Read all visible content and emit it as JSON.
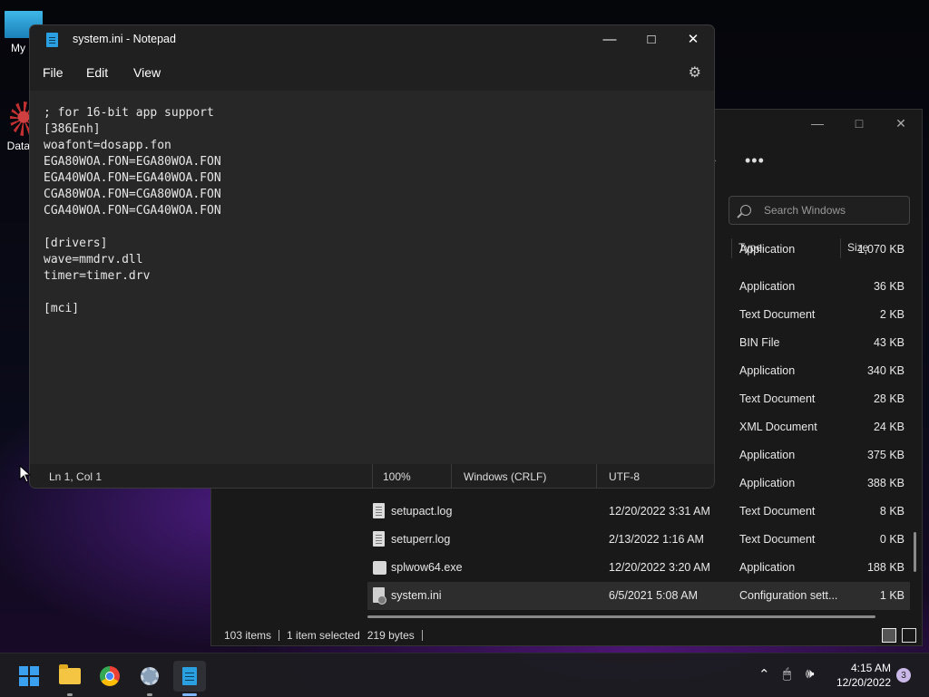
{
  "desktop": {
    "icons": [
      {
        "label": "My C"
      },
      {
        "label": "DataW"
      }
    ]
  },
  "explorer": {
    "search_placeholder": "Search Windows",
    "more_label": "•••",
    "columns": {
      "type": "Type",
      "size": "Size"
    },
    "partial_rows": [
      {
        "type": "Application",
        "size": "1,070 KB"
      },
      {
        "type": "Application",
        "size": "36 KB"
      },
      {
        "type": "Text Document",
        "size": "2 KB"
      },
      {
        "type": "BIN File",
        "size": "43 KB"
      },
      {
        "type": "Application",
        "size": "340 KB"
      },
      {
        "type": "Text Document",
        "size": "28 KB"
      },
      {
        "type": "XML Document",
        "size": "24 KB"
      },
      {
        "type": "Application",
        "size": "375 KB"
      },
      {
        "type": "Application",
        "size": "388 KB"
      }
    ],
    "rows": [
      {
        "name": "setupact.log",
        "date": "12/20/2022 3:31 AM",
        "type": "Text Document",
        "size": "8 KB",
        "icon": "document-icon"
      },
      {
        "name": "setuperr.log",
        "date": "2/13/2022 1:16 AM",
        "type": "Text Document",
        "size": "0 KB",
        "icon": "document-icon"
      },
      {
        "name": "splwow64.exe",
        "date": "12/20/2022 3:20 AM",
        "type": "Application",
        "size": "188 KB",
        "icon": "printer-icon"
      },
      {
        "name": "system.ini",
        "date": "6/5/2021 5:08 AM",
        "type": "Configuration sett...",
        "size": "1 KB",
        "icon": "config-file-icon"
      }
    ],
    "status": {
      "items": "103 items",
      "selected": "1 item selected",
      "bytes": "219 bytes"
    }
  },
  "notepad": {
    "title": "system.ini - Notepad",
    "menu": {
      "file": "File",
      "edit": "Edit",
      "view": "View"
    },
    "content": "; for 16-bit app support\n[386Enh]\nwoafont=dosapp.fon\nEGA80WOA.FON=EGA80WOA.FON\nEGA40WOA.FON=EGA40WOA.FON\nCGA80WOA.FON=CGA80WOA.FON\nCGA40WOA.FON=CGA40WOA.FON\n\n[drivers]\nwave=mmdrv.dll\ntimer=timer.drv\n\n[mci]",
    "status": {
      "position": "Ln 1, Col 1",
      "zoom": "100%",
      "line_ending": "Windows (CRLF)",
      "encoding": "UTF-8"
    }
  },
  "taskbar": {
    "time": "4:15 AM",
    "date": "12/20/2022",
    "notification_count": "3"
  }
}
